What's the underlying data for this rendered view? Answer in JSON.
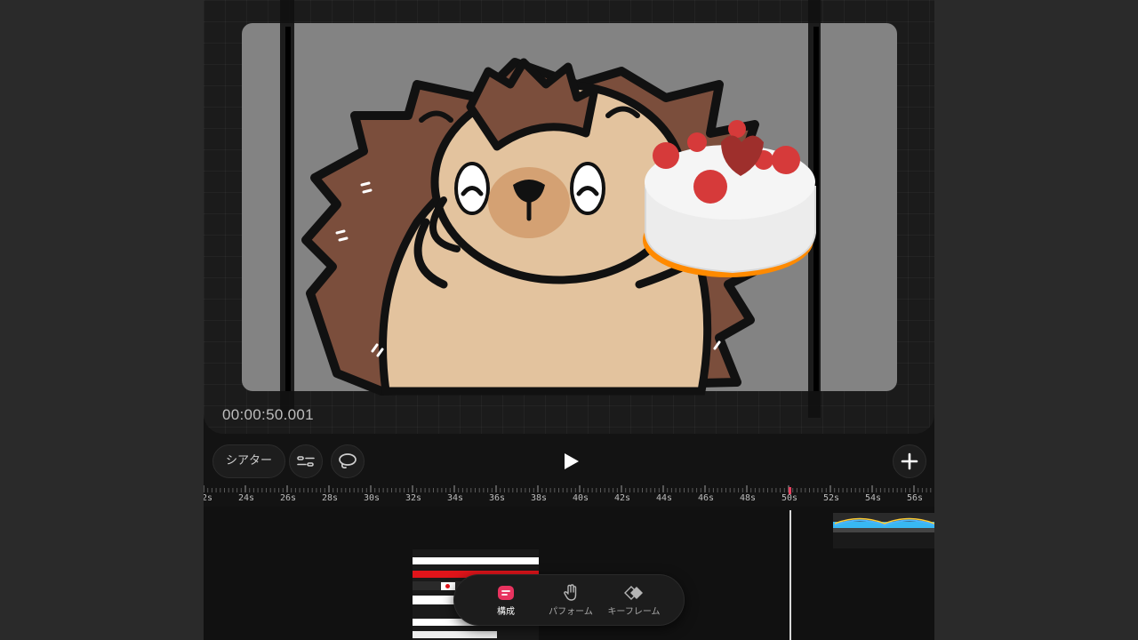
{
  "preview": {
    "timecode": "00:00:50.001"
  },
  "toolbar": {
    "theater_label": "シアター",
    "play_icon": "play-icon",
    "add_icon": "plus-icon"
  },
  "ruler": {
    "labels": [
      "2s",
      "24s",
      "26s",
      "28s",
      "30s",
      "32s",
      "34s",
      "36s",
      "38s",
      "40s",
      "42s",
      "44s",
      "46s",
      "48s",
      "50s",
      "52s",
      "54s",
      "56s"
    ]
  },
  "nav": {
    "items": [
      {
        "label": "構成",
        "icon": "compose-icon",
        "active": true
      },
      {
        "label": "パフォーム",
        "icon": "hand-icon",
        "active": false
      },
      {
        "label": "キーフレーム",
        "icon": "keyframe-icon",
        "active": false
      }
    ]
  },
  "colors": {
    "accent": "#e8335f",
    "background": "#131313",
    "canvas": "#838383",
    "playhead_marker": "#e84060"
  }
}
